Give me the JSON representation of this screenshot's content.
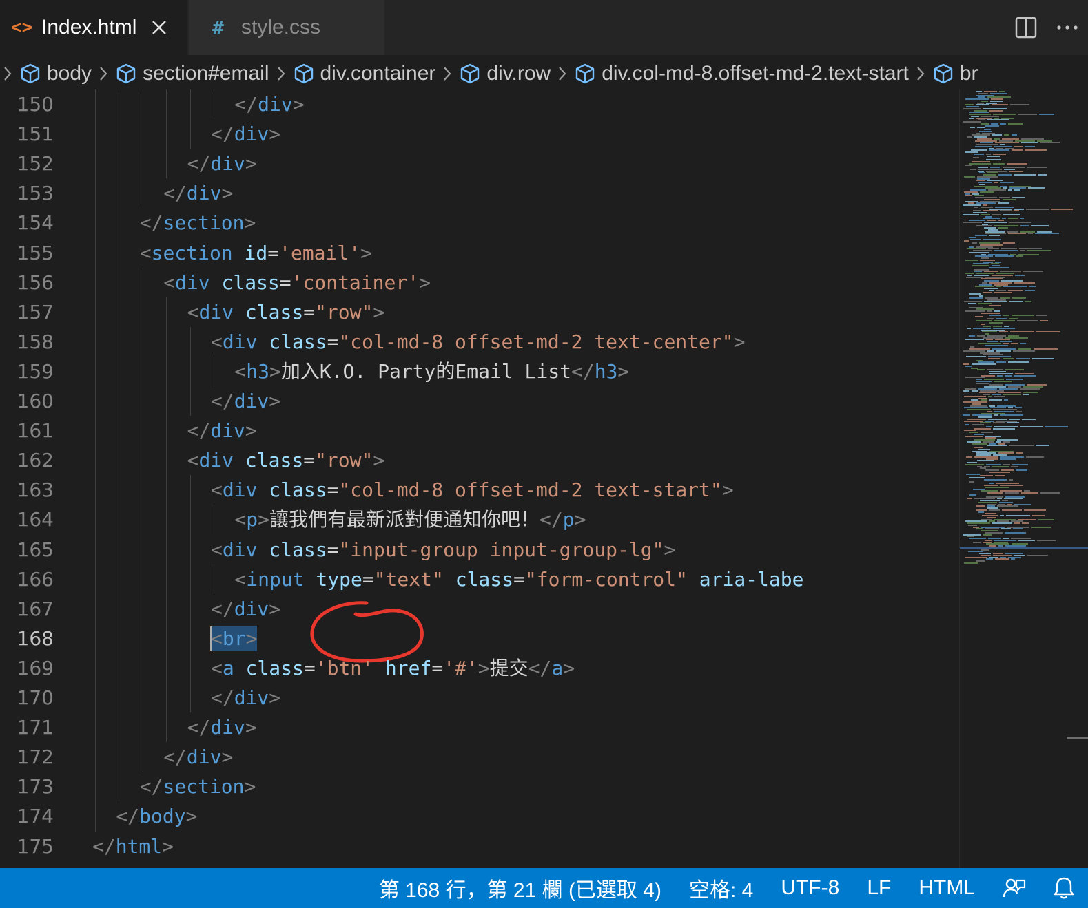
{
  "tabs": [
    {
      "icon": "html-file-icon",
      "label": "Index.html",
      "active": true
    },
    {
      "icon": "css-file-icon",
      "label": "style.css",
      "active": false
    }
  ],
  "tab_icons": {
    "html": "<>",
    "css": "#"
  },
  "breadcrumb": [
    "body",
    "section#email",
    "div.container",
    "div.row",
    "div.col-md-8.offset-md-2.text-start",
    "br"
  ],
  "editor": {
    "current_line": 168,
    "lines": [
      {
        "n": 150,
        "indent": 8,
        "tokens": [
          [
            "punc",
            "</"
          ],
          [
            "tag",
            "div"
          ],
          [
            "punc",
            ">"
          ]
        ]
      },
      {
        "n": 151,
        "indent": 7,
        "tokens": [
          [
            "punc",
            "</"
          ],
          [
            "tag",
            "div"
          ],
          [
            "punc",
            ">"
          ]
        ]
      },
      {
        "n": 152,
        "indent": 6,
        "tokens": [
          [
            "punc",
            "</"
          ],
          [
            "tag",
            "div"
          ],
          [
            "punc",
            ">"
          ]
        ]
      },
      {
        "n": 153,
        "indent": 5,
        "tokens": [
          [
            "punc",
            "</"
          ],
          [
            "tag",
            "div"
          ],
          [
            "punc",
            ">"
          ]
        ]
      },
      {
        "n": 154,
        "indent": 4,
        "tokens": [
          [
            "punc",
            "</"
          ],
          [
            "tag",
            "section"
          ],
          [
            "punc",
            ">"
          ]
        ]
      },
      {
        "n": 155,
        "indent": 4,
        "tokens": [
          [
            "punc",
            "<"
          ],
          [
            "tag",
            "section"
          ],
          [
            "op",
            " "
          ],
          [
            "attr",
            "id"
          ],
          [
            "op",
            "="
          ],
          [
            "str",
            "'email'"
          ],
          [
            "punc",
            ">"
          ]
        ]
      },
      {
        "n": 156,
        "indent": 5,
        "tokens": [
          [
            "punc",
            "<"
          ],
          [
            "tag",
            "div"
          ],
          [
            "op",
            " "
          ],
          [
            "attr",
            "class"
          ],
          [
            "op",
            "="
          ],
          [
            "str",
            "'container'"
          ],
          [
            "punc",
            ">"
          ]
        ]
      },
      {
        "n": 157,
        "indent": 6,
        "tokens": [
          [
            "punc",
            "<"
          ],
          [
            "tag",
            "div"
          ],
          [
            "op",
            " "
          ],
          [
            "attr",
            "class"
          ],
          [
            "op",
            "="
          ],
          [
            "str",
            "\"row\""
          ],
          [
            "punc",
            ">"
          ]
        ]
      },
      {
        "n": 158,
        "indent": 7,
        "tokens": [
          [
            "punc",
            "<"
          ],
          [
            "tag",
            "div"
          ],
          [
            "op",
            " "
          ],
          [
            "attr",
            "class"
          ],
          [
            "op",
            "="
          ],
          [
            "str",
            "\"col-md-8 offset-md-2 text-center\""
          ],
          [
            "punc",
            ">"
          ]
        ]
      },
      {
        "n": 159,
        "indent": 8,
        "tokens": [
          [
            "punc",
            "<"
          ],
          [
            "tag",
            "h3"
          ],
          [
            "punc",
            ">"
          ],
          [
            "text",
            "加入K.O. Party的Email List"
          ],
          [
            "punc",
            "</"
          ],
          [
            "tag",
            "h3"
          ],
          [
            "punc",
            ">"
          ]
        ]
      },
      {
        "n": 160,
        "indent": 7,
        "tokens": [
          [
            "punc",
            "</"
          ],
          [
            "tag",
            "div"
          ],
          [
            "punc",
            ">"
          ]
        ]
      },
      {
        "n": 161,
        "indent": 6,
        "tokens": [
          [
            "punc",
            "</"
          ],
          [
            "tag",
            "div"
          ],
          [
            "punc",
            ">"
          ]
        ]
      },
      {
        "n": 162,
        "indent": 6,
        "tokens": [
          [
            "punc",
            "<"
          ],
          [
            "tag",
            "div"
          ],
          [
            "op",
            " "
          ],
          [
            "attr",
            "class"
          ],
          [
            "op",
            "="
          ],
          [
            "str",
            "\"row\""
          ],
          [
            "punc",
            ">"
          ]
        ]
      },
      {
        "n": 163,
        "indent": 7,
        "tokens": [
          [
            "punc",
            "<"
          ],
          [
            "tag",
            "div"
          ],
          [
            "op",
            " "
          ],
          [
            "attr",
            "class"
          ],
          [
            "op",
            "="
          ],
          [
            "str",
            "\"col-md-8 offset-md-2 text-start\""
          ],
          [
            "punc",
            ">"
          ]
        ]
      },
      {
        "n": 164,
        "indent": 8,
        "tokens": [
          [
            "punc",
            "<"
          ],
          [
            "tag",
            "p"
          ],
          [
            "punc",
            ">"
          ],
          [
            "text",
            "讓我們有最新派對便通知你吧！"
          ],
          [
            "punc",
            "</"
          ],
          [
            "tag",
            "p"
          ],
          [
            "punc",
            ">"
          ]
        ]
      },
      {
        "n": 165,
        "indent": 7,
        "tokens": [
          [
            "punc",
            "<"
          ],
          [
            "tag",
            "div"
          ],
          [
            "op",
            " "
          ],
          [
            "attr",
            "class"
          ],
          [
            "op",
            "="
          ],
          [
            "str",
            "\"input-group input-group-lg\""
          ],
          [
            "punc",
            ">"
          ]
        ]
      },
      {
        "n": 166,
        "indent": 8,
        "tokens": [
          [
            "punc",
            "<"
          ],
          [
            "tag",
            "input"
          ],
          [
            "op",
            " "
          ],
          [
            "attr",
            "type"
          ],
          [
            "op",
            "="
          ],
          [
            "str",
            "\"text\""
          ],
          [
            "op",
            " "
          ],
          [
            "attr",
            "class"
          ],
          [
            "op",
            "="
          ],
          [
            "str",
            "\"form-control\""
          ],
          [
            "op",
            " "
          ],
          [
            "attr",
            "aria-labe"
          ]
        ]
      },
      {
        "n": 167,
        "indent": 7,
        "tokens": [
          [
            "punc",
            "</"
          ],
          [
            "tag",
            "div"
          ],
          [
            "punc",
            ">"
          ]
        ]
      },
      {
        "n": 168,
        "indent": 7,
        "tokens": [
          [
            "punc",
            "<"
          ],
          [
            "tag",
            "br"
          ],
          [
            "punc",
            ">"
          ]
        ]
      },
      {
        "n": 169,
        "indent": 7,
        "tokens": [
          [
            "punc",
            "<"
          ],
          [
            "tag",
            "a"
          ],
          [
            "op",
            " "
          ],
          [
            "attr",
            "class"
          ],
          [
            "op",
            "="
          ],
          [
            "str",
            "'btn'"
          ],
          [
            "op",
            " "
          ],
          [
            "attr",
            "href"
          ],
          [
            "op",
            "="
          ],
          [
            "str",
            "'#'"
          ],
          [
            "punc",
            ">"
          ],
          [
            "text",
            "提交"
          ],
          [
            "punc",
            "</"
          ],
          [
            "tag",
            "a"
          ],
          [
            "punc",
            ">"
          ]
        ]
      },
      {
        "n": 170,
        "indent": 7,
        "tokens": [
          [
            "punc",
            "</"
          ],
          [
            "tag",
            "div"
          ],
          [
            "punc",
            ">"
          ]
        ]
      },
      {
        "n": 171,
        "indent": 6,
        "tokens": [
          [
            "punc",
            "</"
          ],
          [
            "tag",
            "div"
          ],
          [
            "punc",
            ">"
          ]
        ]
      },
      {
        "n": 172,
        "indent": 5,
        "tokens": [
          [
            "punc",
            "</"
          ],
          [
            "tag",
            "div"
          ],
          [
            "punc",
            ">"
          ]
        ]
      },
      {
        "n": 173,
        "indent": 4,
        "tokens": [
          [
            "punc",
            "</"
          ],
          [
            "tag",
            "section"
          ],
          [
            "punc",
            ">"
          ]
        ]
      },
      {
        "n": 174,
        "indent": 3,
        "tokens": [
          [
            "punc",
            "</"
          ],
          [
            "tag",
            "body"
          ],
          [
            "punc",
            ">"
          ]
        ]
      },
      {
        "n": 175,
        "indent": 2,
        "tokens": [
          [
            "punc",
            "</"
          ],
          [
            "tag",
            "html"
          ],
          [
            "punc",
            ">"
          ]
        ]
      }
    ]
  },
  "annotation": {
    "color": "#e8372c",
    "shape": "hand-drawn circle around <br>"
  },
  "statusbar": {
    "position": "第 168 行，第 21 欄 (已選取 4)",
    "indent": "空格: 4",
    "encoding": "UTF-8",
    "eol": "LF",
    "language": "HTML"
  },
  "colors": {
    "tag": "#569cd6",
    "attr": "#9cdcfe",
    "string": "#ce9178",
    "punctuation": "#808080",
    "text": "#d4d4d4",
    "statusbar": "#007acc",
    "selection": "#264f78",
    "editor_bg": "#1e1e1e"
  }
}
